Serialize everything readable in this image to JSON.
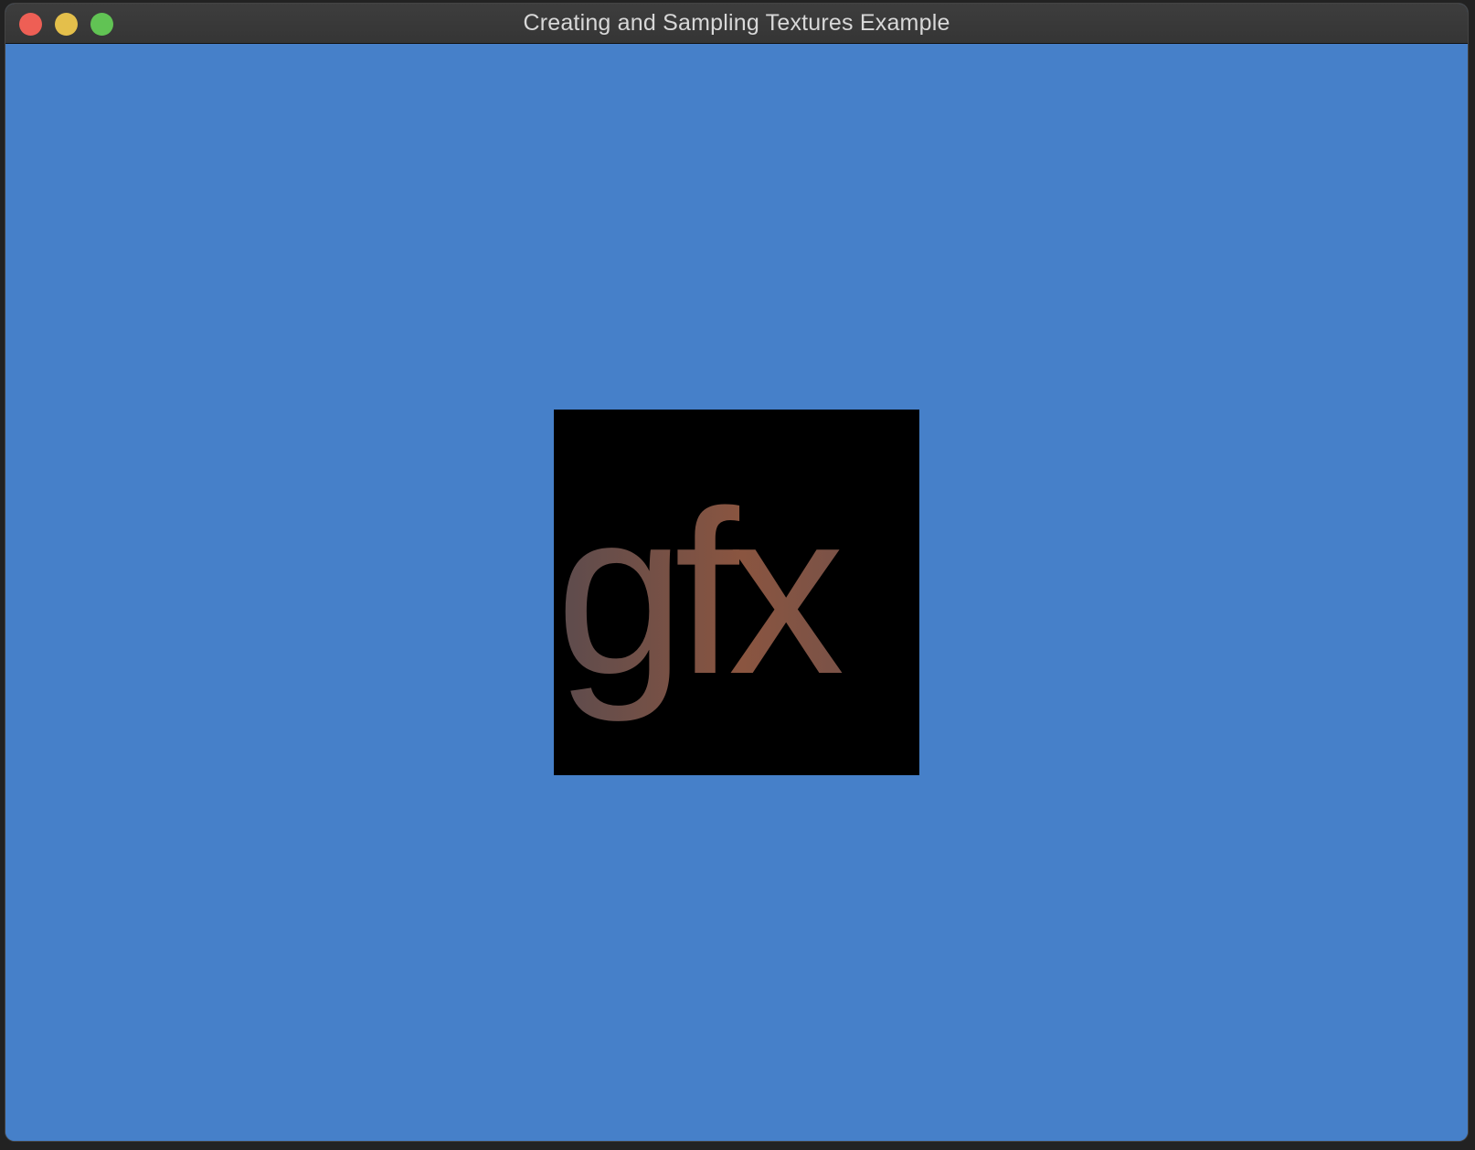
{
  "window": {
    "title": "Creating and Sampling Textures Example"
  },
  "controls": {
    "close": "close-button",
    "minimize": "minimize-button",
    "maximize": "maximize-button"
  },
  "texture": {
    "text": "gfx",
    "background_color": "#000000",
    "gradient_start": "#5c4b4d",
    "gradient_end": "#8a5540"
  },
  "viewport": {
    "clear_color": "#4680c9"
  }
}
